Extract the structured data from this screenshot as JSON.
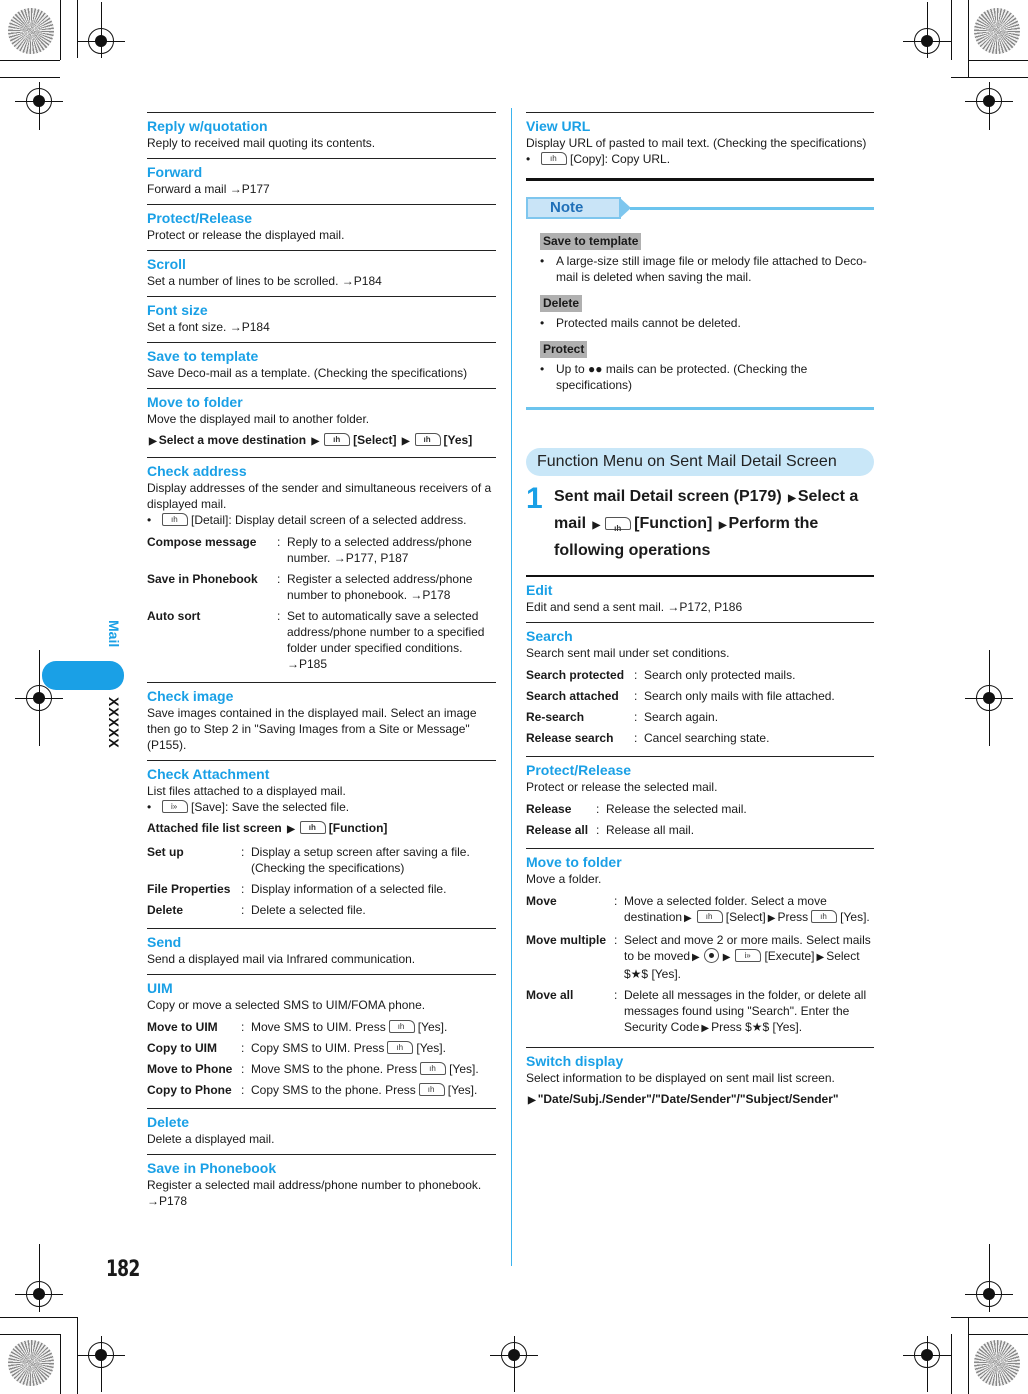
{
  "sidebar": {
    "chapter": "Mail",
    "subsection": "XXXXX"
  },
  "page_number": "182",
  "left_column": {
    "sections": [
      {
        "title": "Reply w/quotation",
        "desc": "Reply to received mail quoting its contents."
      },
      {
        "title": "Forward",
        "desc": "Forward a mail →P177"
      },
      {
        "title": "Protect/Release",
        "desc": "Protect or release the displayed mail."
      },
      {
        "title": "Scroll",
        "desc": "Set a number of lines to be scrolled. →P184"
      },
      {
        "title": "Font size",
        "desc": "Set a font size. →P184"
      },
      {
        "title": "Save to template",
        "desc": "Save Deco-mail as a template. (Checking the specifications)"
      },
      {
        "title": "Move to folder",
        "desc": "Move the displayed mail to another folder.",
        "proc": {
          "p1": "Select a move destination",
          "p2": "[Select]",
          "p3": "[Yes]"
        }
      },
      {
        "title": "Check address",
        "desc": "Display addresses of the sender and simultaneous receivers of a displayed mail.",
        "bullet": "[Detail]: Display detail screen of a selected address.",
        "items": [
          {
            "k": "Compose message",
            "v": "Reply to a selected address/phone number. →P177, P187"
          },
          {
            "k": "Save in Phonebook",
            "v": "Register a selected address/phone number to phonebook. →P178"
          },
          {
            "k": "Auto sort",
            "v": "Set to automatically save a selected address/phone number to a specified folder under specified conditions. →P185"
          }
        ]
      },
      {
        "title": "Check image",
        "desc": "Save images contained in the displayed mail. Select an image then go to Step 2 in \"Saving Images from a Site or Message\" (P155)."
      },
      {
        "title": "Check Attachment",
        "desc": "List files attached to a displayed mail.",
        "bullet": "[Save]: Save the selected file.",
        "proc": {
          "p1": "Attached file list screen",
          "p2": "[Function]"
        },
        "items": [
          {
            "k": "Set up",
            "v": "Display a setup screen after saving a file. (Checking the specifications)"
          },
          {
            "k": "File Properties",
            "v": "Display information of a selected file."
          },
          {
            "k": "Delete",
            "v": "Delete a selected file."
          }
        ]
      },
      {
        "title": "Send",
        "desc": "Send a displayed mail via Infrared communication."
      },
      {
        "title": "UIM",
        "desc": "Copy or move a selected SMS to UIM/FOMA phone.",
        "items": [
          {
            "k": "Move to UIM",
            "v1": "Move SMS to UIM. Press",
            "v2": "[Yes]."
          },
          {
            "k": "Copy to UIM",
            "v1": "Copy SMS to UIM. Press",
            "v2": "[Yes]."
          },
          {
            "k": "Move to Phone",
            "v1": "Move SMS to the phone. Press",
            "v2": "[Yes]."
          },
          {
            "k": "Copy to Phone",
            "v1": "Copy SMS to the phone. Press",
            "v2": "[Yes]."
          }
        ]
      },
      {
        "title": "Delete",
        "desc": "Delete a displayed mail."
      },
      {
        "title": "Save in Phonebook",
        "desc": "Register a selected mail address/phone number to phonebook. →P178"
      }
    ]
  },
  "right_column": {
    "view_url": {
      "title": "View URL",
      "desc": "Display URL of pasted to mail text. (Checking the specifications)",
      "bullet": "[Copy]: Copy URL."
    },
    "note": {
      "label": "Note",
      "items": [
        {
          "tag": "Save to template",
          "text": "A large-size still image file or melody file attached to Deco-mail is deleted when saving the mail."
        },
        {
          "tag": "Delete",
          "text": "Protected mails cannot be deleted."
        },
        {
          "tag": "Protect",
          "text": "Up to ●● mails can be protected. (Checking the specifications)"
        }
      ]
    },
    "function_menu": {
      "header": "Function Menu on Sent Mail Detail Screen",
      "step_number": "1",
      "step": {
        "a": "Sent mail Detail screen (P179)",
        "b": "Select a mail",
        "c": "[Function]",
        "d": "Perform the following operations"
      }
    },
    "sections": [
      {
        "title": "Edit",
        "desc": "Edit and send a sent mail. →P172, P186"
      },
      {
        "title": "Search",
        "desc": "Search sent mail under set conditions.",
        "items": [
          {
            "k": "Search protected",
            "v": "Search only protected mails."
          },
          {
            "k": "Search attached",
            "v": "Search only mails with file attached."
          },
          {
            "k": "Re-search",
            "v": "Search again."
          },
          {
            "k": "Release search",
            "v": "Cancel searching state."
          }
        ]
      },
      {
        "title": "Protect/Release",
        "desc": "Protect or release the selected mail.",
        "items": [
          {
            "k": "Release",
            "v": "Release the selected mail."
          },
          {
            "k": "Release all",
            "v": "Release all mail."
          }
        ]
      },
      {
        "title": "Move to folder",
        "desc": "Move a folder.",
        "items": [
          {
            "k": "Move",
            "v1": "Move a selected folder. Select a move destination",
            "v2": "[Select]",
            "v3": "Press",
            "v4": "[Yes]."
          },
          {
            "k": "Move multiple",
            "v1": "Select and move 2 or more mails. Select mails to be moved",
            "v2": "[Execute]",
            "v3": "Select $★$ [Yes]."
          },
          {
            "k": "Move all",
            "v1": "Delete all messages in the folder, or delete all messages found using \"Search\". Enter the Security Code",
            "v2": "Press $★$ [Yes]."
          }
        ]
      },
      {
        "title": "Switch display",
        "desc": "Select information to be displayed on sent mail list screen.",
        "proc": "\"Date/Subj./Sender\"/\"Date/Sender\"/\"Subject/Sender\""
      }
    ]
  },
  "colors": {
    "accent": "#1aa0e6",
    "note_blue": "#6cc4ee",
    "header_bg": "#c9e7f8",
    "tag_gray": "#b0b0b0"
  }
}
